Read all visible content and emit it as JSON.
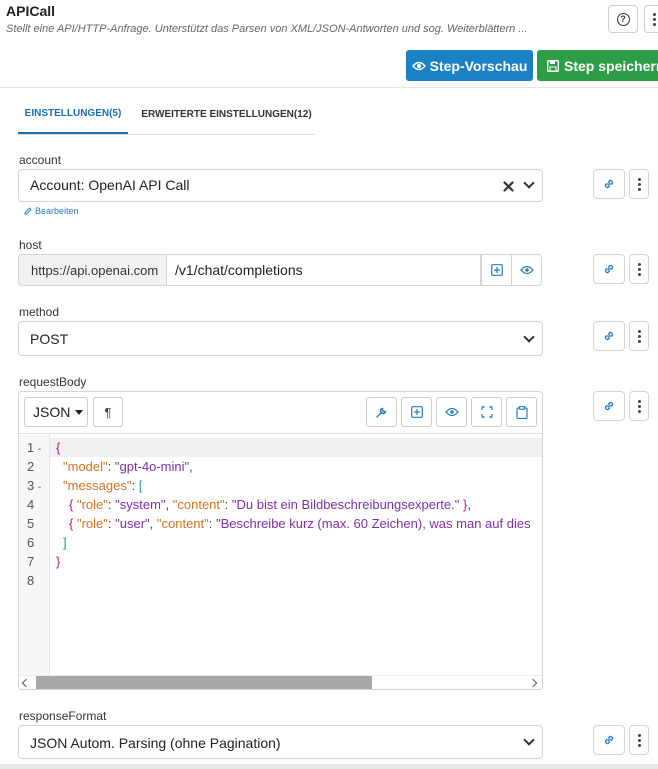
{
  "header": {
    "title": "APICall",
    "subtitle": "Stellt eine API/HTTP-Anfrage. Unterstützt das Parsen von XML/JSON-Antworten und sog. Weiterblättern ...",
    "preview_label": "Step-Vorschau",
    "save_label": "Step speichern"
  },
  "tabs": [
    {
      "label": "EINSTELLUNGEN(5)",
      "active": true
    },
    {
      "label": "ERWEITERTE EINSTELLUNGEN(12)",
      "active": false
    }
  ],
  "account": {
    "label": "account",
    "value": "Account: OpenAI API Call",
    "edit_link": "Bearbeiten"
  },
  "host": {
    "label": "host",
    "prefix": "https://api.openai.com",
    "path": "/v1/chat/completions"
  },
  "method": {
    "label": "method",
    "value": "POST"
  },
  "request_body": {
    "label": "requestBody",
    "format": "JSON",
    "line_numbers": [
      "1",
      "2",
      "3",
      "4",
      "5",
      "6",
      "7",
      "8"
    ],
    "code": {
      "l1": "{",
      "l2_key": "\"model\"",
      "l2_val": "\"gpt-4o-mini\"",
      "l3_key": "\"messages\"",
      "l3_open": "[",
      "l4_k1": "\"role\"",
      "l4_v1": "\"system\"",
      "l4_k2": "\"content\"",
      "l4_v2": "\"Du bist ein Bildbeschreibungsexperte.\"",
      "l5_k1": "\"role\"",
      "l5_v1": "\"user\"",
      "l5_k2": "\"content\"",
      "l5_v2": "\"Beschreibe kurz (max. 60 Zeichen), was man auf dies",
      "l6": "]",
      "l7": "}"
    }
  },
  "response_format": {
    "label": "responseFormat",
    "value": "JSON Autom. Parsing (ohne Pagination)"
  },
  "colors": {
    "primary": "#1a82c4",
    "success": "#2e9d47",
    "tab_active": "#1a6fb0"
  }
}
